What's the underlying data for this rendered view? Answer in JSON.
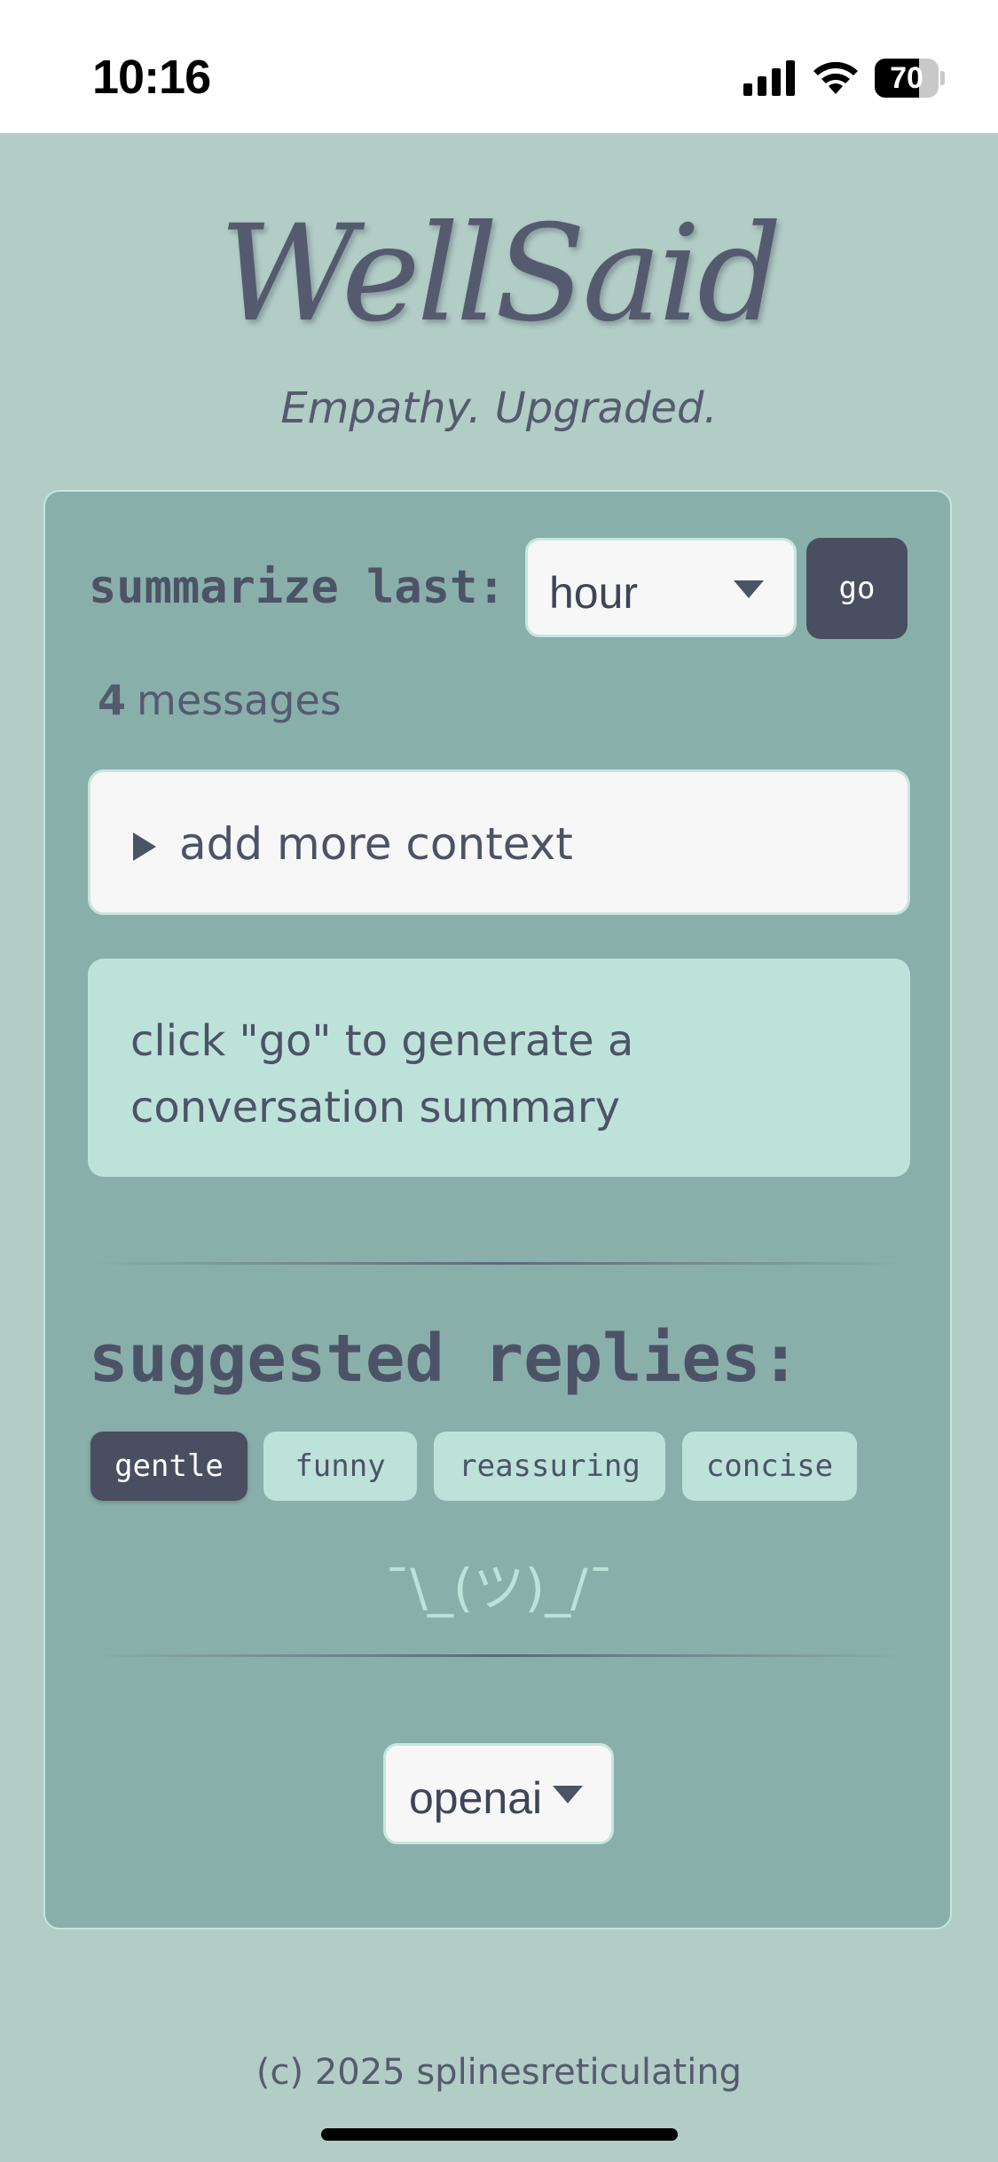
{
  "status_bar": {
    "time": "10:16",
    "battery_level": "70",
    "battery_fraction": 0.7
  },
  "app": {
    "logo_text": "WellSaid",
    "tagline": "Empathy. Upgraded."
  },
  "summarize": {
    "label": "summarize last:",
    "period_selected": "hour",
    "go_label": "go",
    "message_count": "4",
    "message_count_label": "messages"
  },
  "context": {
    "toggle_label": "add more context"
  },
  "summary": {
    "placeholder_text": "click \"go\" to generate a conversation summary"
  },
  "replies": {
    "heading": "suggested replies:",
    "tones": [
      {
        "label": "gentle",
        "active": true
      },
      {
        "label": "funny",
        "active": false
      },
      {
        "label": "reassuring",
        "active": false
      },
      {
        "label": "concise",
        "active": false
      }
    ],
    "empty_state": "¯\\_(ツ)_/¯"
  },
  "provider": {
    "selected": "openai"
  },
  "footer": {
    "copyright": "(c) 2025 splinesreticulating"
  },
  "colors": {
    "page_background": "#b2ccc6",
    "card_background": "#89afab",
    "accent_dark": "#4a4e61",
    "accent_light": "#bde2da",
    "text": "#4d5366"
  }
}
